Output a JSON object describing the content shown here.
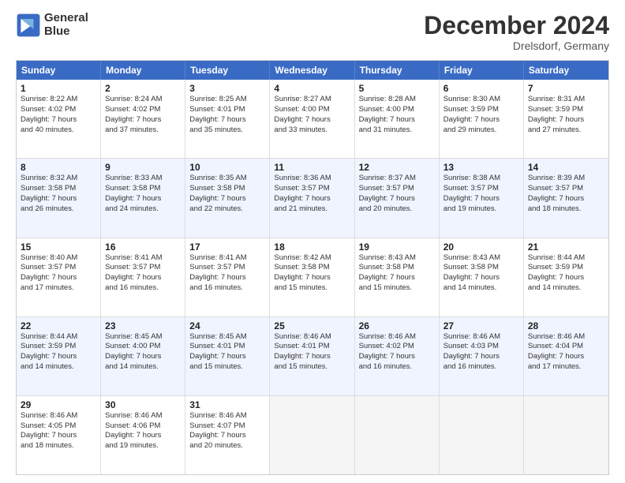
{
  "header": {
    "logo_line1": "General",
    "logo_line2": "Blue",
    "title": "December 2024",
    "subtitle": "Drelsdorf, Germany"
  },
  "calendar": {
    "days_of_week": [
      "Sunday",
      "Monday",
      "Tuesday",
      "Wednesday",
      "Thursday",
      "Friday",
      "Saturday"
    ],
    "rows": [
      [
        {
          "day": "1",
          "lines": [
            "Sunrise: 8:22 AM",
            "Sunset: 4:02 PM",
            "Daylight: 7 hours",
            "and 40 minutes."
          ]
        },
        {
          "day": "2",
          "lines": [
            "Sunrise: 8:24 AM",
            "Sunset: 4:02 PM",
            "Daylight: 7 hours",
            "and 37 minutes."
          ]
        },
        {
          "day": "3",
          "lines": [
            "Sunrise: 8:25 AM",
            "Sunset: 4:01 PM",
            "Daylight: 7 hours",
            "and 35 minutes."
          ]
        },
        {
          "day": "4",
          "lines": [
            "Sunrise: 8:27 AM",
            "Sunset: 4:00 PM",
            "Daylight: 7 hours",
            "and 33 minutes."
          ]
        },
        {
          "day": "5",
          "lines": [
            "Sunrise: 8:28 AM",
            "Sunset: 4:00 PM",
            "Daylight: 7 hours",
            "and 31 minutes."
          ]
        },
        {
          "day": "6",
          "lines": [
            "Sunrise: 8:30 AM",
            "Sunset: 3:59 PM",
            "Daylight: 7 hours",
            "and 29 minutes."
          ]
        },
        {
          "day": "7",
          "lines": [
            "Sunrise: 8:31 AM",
            "Sunset: 3:59 PM",
            "Daylight: 7 hours",
            "and 27 minutes."
          ]
        }
      ],
      [
        {
          "day": "8",
          "lines": [
            "Sunrise: 8:32 AM",
            "Sunset: 3:58 PM",
            "Daylight: 7 hours",
            "and 26 minutes."
          ]
        },
        {
          "day": "9",
          "lines": [
            "Sunrise: 8:33 AM",
            "Sunset: 3:58 PM",
            "Daylight: 7 hours",
            "and 24 minutes."
          ]
        },
        {
          "day": "10",
          "lines": [
            "Sunrise: 8:35 AM",
            "Sunset: 3:58 PM",
            "Daylight: 7 hours",
            "and 22 minutes."
          ]
        },
        {
          "day": "11",
          "lines": [
            "Sunrise: 8:36 AM",
            "Sunset: 3:57 PM",
            "Daylight: 7 hours",
            "and 21 minutes."
          ]
        },
        {
          "day": "12",
          "lines": [
            "Sunrise: 8:37 AM",
            "Sunset: 3:57 PM",
            "Daylight: 7 hours",
            "and 20 minutes."
          ]
        },
        {
          "day": "13",
          "lines": [
            "Sunrise: 8:38 AM",
            "Sunset: 3:57 PM",
            "Daylight: 7 hours",
            "and 19 minutes."
          ]
        },
        {
          "day": "14",
          "lines": [
            "Sunrise: 8:39 AM",
            "Sunset: 3:57 PM",
            "Daylight: 7 hours",
            "and 18 minutes."
          ]
        }
      ],
      [
        {
          "day": "15",
          "lines": [
            "Sunrise: 8:40 AM",
            "Sunset: 3:57 PM",
            "Daylight: 7 hours",
            "and 17 minutes."
          ]
        },
        {
          "day": "16",
          "lines": [
            "Sunrise: 8:41 AM",
            "Sunset: 3:57 PM",
            "Daylight: 7 hours",
            "and 16 minutes."
          ]
        },
        {
          "day": "17",
          "lines": [
            "Sunrise: 8:41 AM",
            "Sunset: 3:57 PM",
            "Daylight: 7 hours",
            "and 16 minutes."
          ]
        },
        {
          "day": "18",
          "lines": [
            "Sunrise: 8:42 AM",
            "Sunset: 3:58 PM",
            "Daylight: 7 hours",
            "and 15 minutes."
          ]
        },
        {
          "day": "19",
          "lines": [
            "Sunrise: 8:43 AM",
            "Sunset: 3:58 PM",
            "Daylight: 7 hours",
            "and 15 minutes."
          ]
        },
        {
          "day": "20",
          "lines": [
            "Sunrise: 8:43 AM",
            "Sunset: 3:58 PM",
            "Daylight: 7 hours",
            "and 14 minutes."
          ]
        },
        {
          "day": "21",
          "lines": [
            "Sunrise: 8:44 AM",
            "Sunset: 3:59 PM",
            "Daylight: 7 hours",
            "and 14 minutes."
          ]
        }
      ],
      [
        {
          "day": "22",
          "lines": [
            "Sunrise: 8:44 AM",
            "Sunset: 3:59 PM",
            "Daylight: 7 hours",
            "and 14 minutes."
          ]
        },
        {
          "day": "23",
          "lines": [
            "Sunrise: 8:45 AM",
            "Sunset: 4:00 PM",
            "Daylight: 7 hours",
            "and 14 minutes."
          ]
        },
        {
          "day": "24",
          "lines": [
            "Sunrise: 8:45 AM",
            "Sunset: 4:01 PM",
            "Daylight: 7 hours",
            "and 15 minutes."
          ]
        },
        {
          "day": "25",
          "lines": [
            "Sunrise: 8:46 AM",
            "Sunset: 4:01 PM",
            "Daylight: 7 hours",
            "and 15 minutes."
          ]
        },
        {
          "day": "26",
          "lines": [
            "Sunrise: 8:46 AM",
            "Sunset: 4:02 PM",
            "Daylight: 7 hours",
            "and 16 minutes."
          ]
        },
        {
          "day": "27",
          "lines": [
            "Sunrise: 8:46 AM",
            "Sunset: 4:03 PM",
            "Daylight: 7 hours",
            "and 16 minutes."
          ]
        },
        {
          "day": "28",
          "lines": [
            "Sunrise: 8:46 AM",
            "Sunset: 4:04 PM",
            "Daylight: 7 hours",
            "and 17 minutes."
          ]
        }
      ],
      [
        {
          "day": "29",
          "lines": [
            "Sunrise: 8:46 AM",
            "Sunset: 4:05 PM",
            "Daylight: 7 hours",
            "and 18 minutes."
          ]
        },
        {
          "day": "30",
          "lines": [
            "Sunrise: 8:46 AM",
            "Sunset: 4:06 PM",
            "Daylight: 7 hours",
            "and 19 minutes."
          ]
        },
        {
          "day": "31",
          "lines": [
            "Sunrise: 8:46 AM",
            "Sunset: 4:07 PM",
            "Daylight: 7 hours",
            "and 20 minutes."
          ]
        },
        null,
        null,
        null,
        null
      ]
    ]
  }
}
